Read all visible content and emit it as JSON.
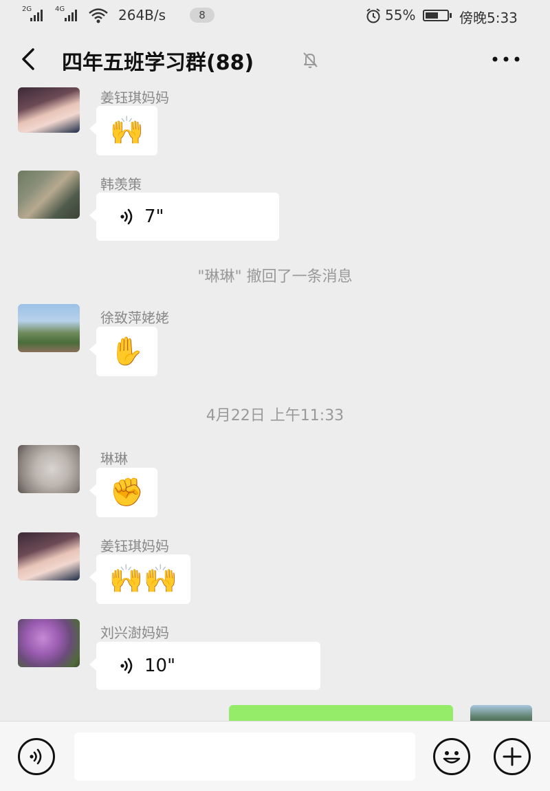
{
  "status_bar": {
    "net1": "2G",
    "net2": "4G",
    "speed": "264B/s",
    "notif_count": "8",
    "battery": "55%",
    "time": "傍晚5:33"
  },
  "header": {
    "title": "四年五班学习群(88)"
  },
  "messages": [
    {
      "sender": "姜钰琪妈妈",
      "content": "🙌",
      "type": "emoji"
    },
    {
      "sender": "韩羡策",
      "content": "7\"",
      "type": "voice"
    },
    {
      "sender": "徐致萍姥姥",
      "content": "✋",
      "type": "emoji"
    },
    {
      "sender": "琳琳",
      "content": "✊",
      "type": "emoji"
    },
    {
      "sender": "姜钰琪妈妈",
      "content": "🙌🙌",
      "type": "emoji"
    },
    {
      "sender": "刘兴澍妈妈",
      "content": "10\"",
      "type": "voice"
    }
  ],
  "system_notices": {
    "recall": "\"琳琳\" 撤回了一条消息",
    "timestamp": "4月22日 上午11:33"
  },
  "colors": {
    "background": "#ededed",
    "bubble": "#ffffff",
    "own_bubble": "#95ec69",
    "meta_text": "#999999"
  },
  "icons": {
    "back": "chevron-left-icon",
    "mute": "bell-off-icon",
    "more": "ellipsis-icon",
    "voice": "voice-wave-icon",
    "emoji": "smiley-icon",
    "plus": "plus-circle-icon"
  }
}
